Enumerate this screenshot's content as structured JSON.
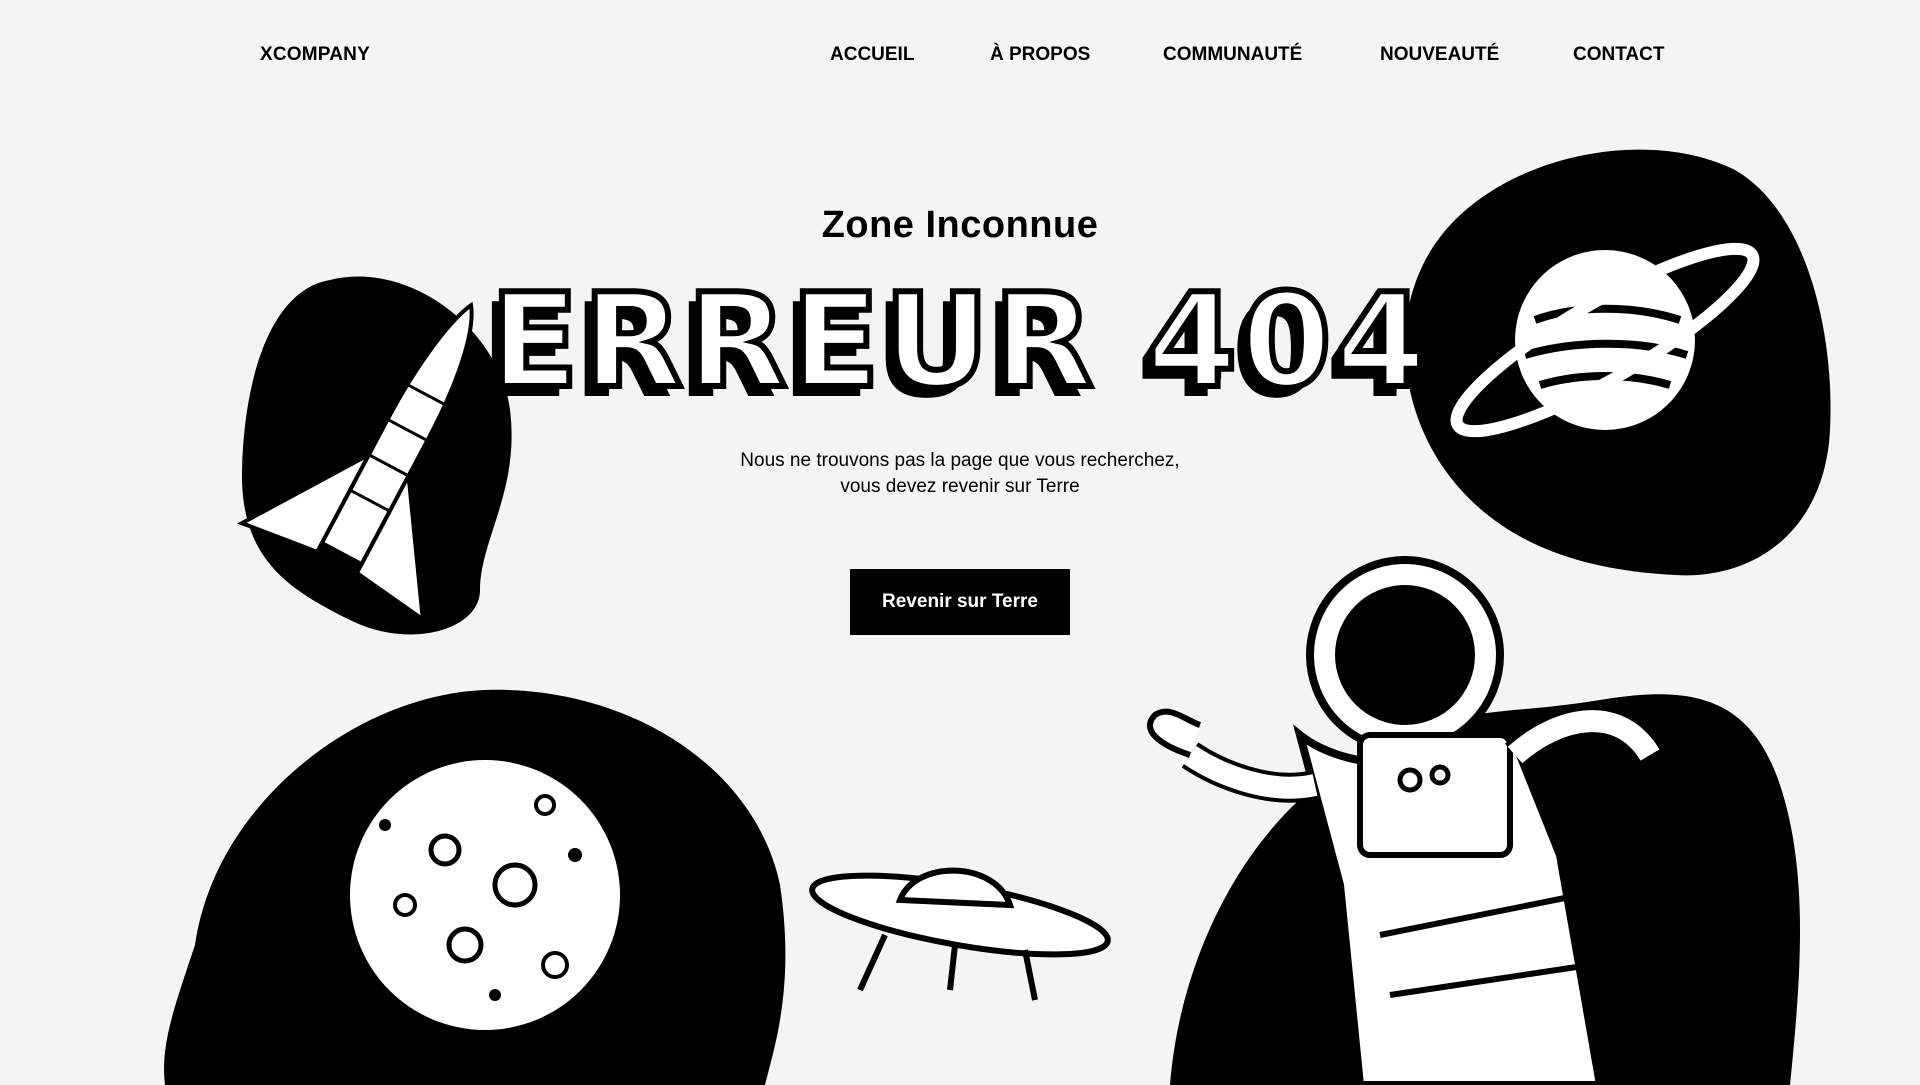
{
  "nav": {
    "brand": "XCOMPANY",
    "items": [
      "ACCUEIL",
      "À PROPOS",
      "COMMUNAUTÉ",
      "NOUVEAUTÉ",
      "CONTACT"
    ]
  },
  "hero": {
    "subtitle": "Zone Inconnue",
    "title": "ERREUR 404",
    "description_line1": "Nous ne trouvons pas la page que vous recherchez,",
    "description_line2": "vous devez revenir sur Terre",
    "cta_label": "Revenir sur Terre"
  },
  "colors": {
    "background": "#f4f4f4",
    "ink": "#000000",
    "paper": "#ffffff"
  },
  "illustrations": [
    "rocket-icon",
    "planet-icon",
    "moon-icon",
    "ufo-icon",
    "astronaut-icon"
  ]
}
